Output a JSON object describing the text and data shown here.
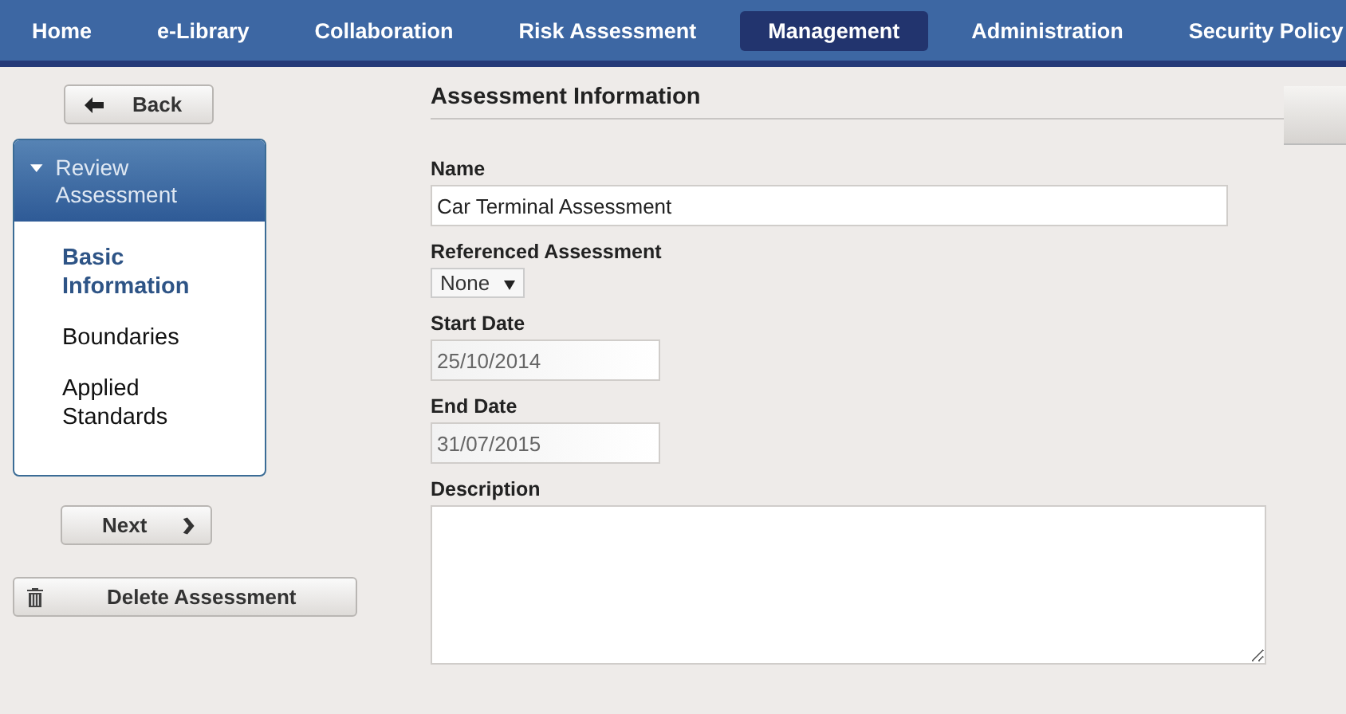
{
  "nav": [
    {
      "label": "Home",
      "selected": false
    },
    {
      "label": "e-Library",
      "selected": false
    },
    {
      "label": "Collaboration",
      "selected": false
    },
    {
      "label": "Risk Assessment",
      "selected": false
    },
    {
      "label": "Management",
      "selected": true
    },
    {
      "label": "Administration",
      "selected": false
    },
    {
      "label": "Security Policy",
      "selected": false
    }
  ],
  "back_button": "Back",
  "sidebar": {
    "title": "Review Assessment",
    "expanded": true,
    "items": [
      {
        "label": "Basic Information",
        "selected": true
      },
      {
        "label": "Boundaries",
        "selected": false
      },
      {
        "label": "Applied Standards",
        "selected": false
      }
    ]
  },
  "next_button": "Next",
  "delete_button": "Delete Assessment",
  "form": {
    "title": "Assessment Information",
    "fields": [
      {
        "kind": "text",
        "label": "Name",
        "value": "Car Terminal Assessment",
        "disabled": false
      },
      {
        "kind": "select",
        "label": "Referenced Assessment",
        "value": "None",
        "disabled": false
      },
      {
        "kind": "date",
        "label": "Start Date",
        "value": "25/10/2014",
        "disabled": true
      },
      {
        "kind": "date",
        "label": "End Date",
        "value": "31/07/2015",
        "disabled": true
      },
      {
        "kind": "textarea",
        "label": "Description",
        "disabled": false
      }
    ]
  }
}
